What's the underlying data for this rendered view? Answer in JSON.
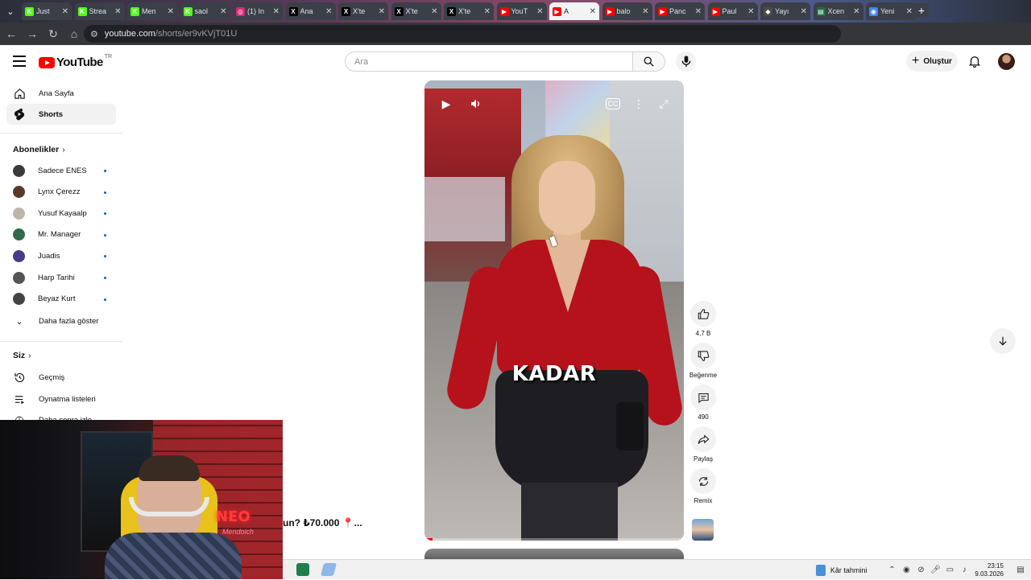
{
  "browser": {
    "tabs": [
      {
        "title": "Just",
        "fav": "K",
        "color": "#53fc18"
      },
      {
        "title": "Strea",
        "fav": "K",
        "color": "#53fc18"
      },
      {
        "title": "Men",
        "fav": "K",
        "color": "#53fc18"
      },
      {
        "title": "saol",
        "fav": "K",
        "color": "#53fc18"
      },
      {
        "title": "(1) In",
        "fav": "◎",
        "color": "#d62976"
      },
      {
        "title": "Ana",
        "fav": "X",
        "color": "#000000"
      },
      {
        "title": "X'te",
        "fav": "X",
        "color": "#000000"
      },
      {
        "title": "X'te",
        "fav": "X",
        "color": "#000000"
      },
      {
        "title": "X'te",
        "fav": "X",
        "color": "#000000"
      },
      {
        "title": "YouT",
        "fav": "▶",
        "color": "#ff0000"
      },
      {
        "title": "A",
        "fav": "▶",
        "color": "#ff0000",
        "active": true
      },
      {
        "title": "balo",
        "fav": "▶",
        "color": "#ff0000"
      },
      {
        "title": "Panc",
        "fav": "▶",
        "color": "#ff0000"
      },
      {
        "title": "Paul",
        "fav": "▶",
        "color": "#ff0000"
      },
      {
        "title": "Yayı",
        "fav": "◆",
        "color": "#4b4b4b"
      },
      {
        "title": "Xcen",
        "fav": "▤",
        "color": "#1d6f42"
      },
      {
        "title": "Yeni",
        "fav": "◉",
        "color": "#4285f4"
      }
    ],
    "close_glyph": "✕",
    "url_host": "youtube.com",
    "url_path": "/shorts/er9vKVjT01U"
  },
  "header": {
    "logo_text": "YouTube",
    "country_code": "TR",
    "search_placeholder": "Ara",
    "create_label": "Oluştur"
  },
  "sidebar": {
    "main": [
      {
        "label": "Ana Sayfa",
        "icon": "home-icon",
        "glyph": "⌂"
      },
      {
        "label": "Shorts",
        "icon": "shorts-icon",
        "glyph": "⚡",
        "active": true
      }
    ],
    "subscriptions_title": "Abonelikler",
    "subscriptions": [
      {
        "name": "Sadece ENES",
        "color": "#3a3a3a"
      },
      {
        "name": "Lynx Çerezz",
        "color": "#5a3b2a"
      },
      {
        "name": "Yusuf Kayaalp",
        "color": "#bfb6a8"
      },
      {
        "name": "Mr. Manager",
        "color": "#2f6a4a"
      },
      {
        "name": "Juadis",
        "color": "#4a3a8a"
      },
      {
        "name": "Harp Tarihi",
        "color": "#555555"
      },
      {
        "name": "Beyaz Kurt",
        "color": "#444444"
      }
    ],
    "show_more": "Daha fazla göster",
    "you_title": "Siz",
    "you_items": [
      {
        "label": "Geçmiş",
        "icon": "history-icon",
        "glyph": "↺"
      },
      {
        "label": "Oynatma listeleri",
        "icon": "playlists-icon",
        "glyph": "☰"
      },
      {
        "label": "Daha sonra izle",
        "icon": "watch-later-icon",
        "glyph": "◷"
      }
    ]
  },
  "video": {
    "caption": "KADAR",
    "progress": 0.03,
    "overlay_title": "un? ₺70.000 📍..."
  },
  "actions": {
    "like_count": "4,7 B",
    "dislike_label": "Beğenme",
    "comment_count": "490",
    "share_label": "Paylaş",
    "remix_label": "Remix"
  },
  "webcam": {
    "neon_text": "NEO",
    "neon_script": "Mendoich"
  },
  "taskbar": {
    "widget_label": "Kâr tahmini",
    "time": "23:15",
    "date": "9.03.2026"
  }
}
